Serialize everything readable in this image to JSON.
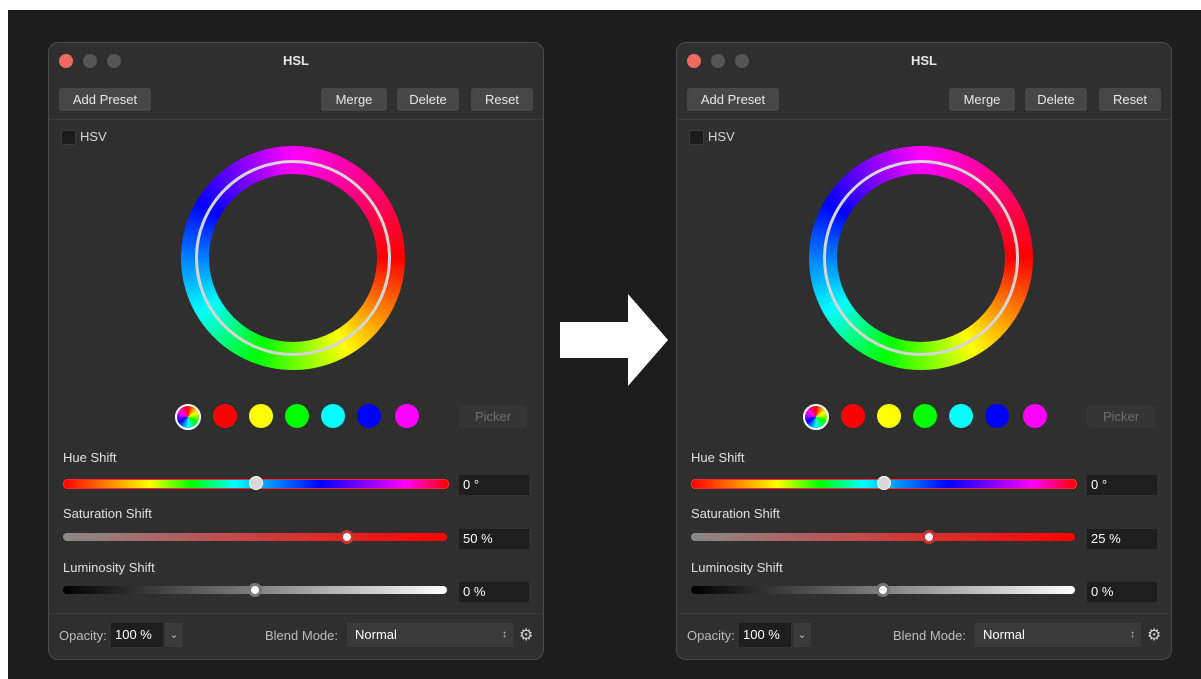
{
  "panels": [
    {
      "title": "HSL",
      "buttons": {
        "add_preset": "Add Preset",
        "merge": "Merge",
        "delete": "Delete",
        "reset": "Reset"
      },
      "hsv_label": "HSV",
      "picker_label": "Picker",
      "hue_shift": {
        "label": "Hue Shift",
        "value": "0 °"
      },
      "saturation_shift": {
        "label": "Saturation Shift",
        "value": "50 %"
      },
      "luminosity_shift": {
        "label": "Luminosity Shift",
        "value": "0 %"
      },
      "footer": {
        "opacity_label": "Opacity:",
        "opacity_value": "100 %",
        "blend_label": "Blend Mode:",
        "blend_value": "Normal"
      }
    },
    {
      "title": "HSL",
      "buttons": {
        "add_preset": "Add Preset",
        "merge": "Merge",
        "delete": "Delete",
        "reset": "Reset"
      },
      "hsv_label": "HSV",
      "picker_label": "Picker",
      "hue_shift": {
        "label": "Hue Shift",
        "value": "0 °"
      },
      "saturation_shift": {
        "label": "Saturation Shift",
        "value": "25 %"
      },
      "luminosity_shift": {
        "label": "Luminosity Shift",
        "value": "0 %"
      },
      "footer": {
        "opacity_label": "Opacity:",
        "opacity_value": "100 %",
        "blend_label": "Blend Mode:",
        "blend_value": "Normal"
      }
    }
  ],
  "colors": {
    "swatches": [
      "#ff0000",
      "#ffff00",
      "#00ff00",
      "#00ffff",
      "#0000ff",
      "#ff00ff"
    ],
    "close_button": "#ed6a5e"
  }
}
